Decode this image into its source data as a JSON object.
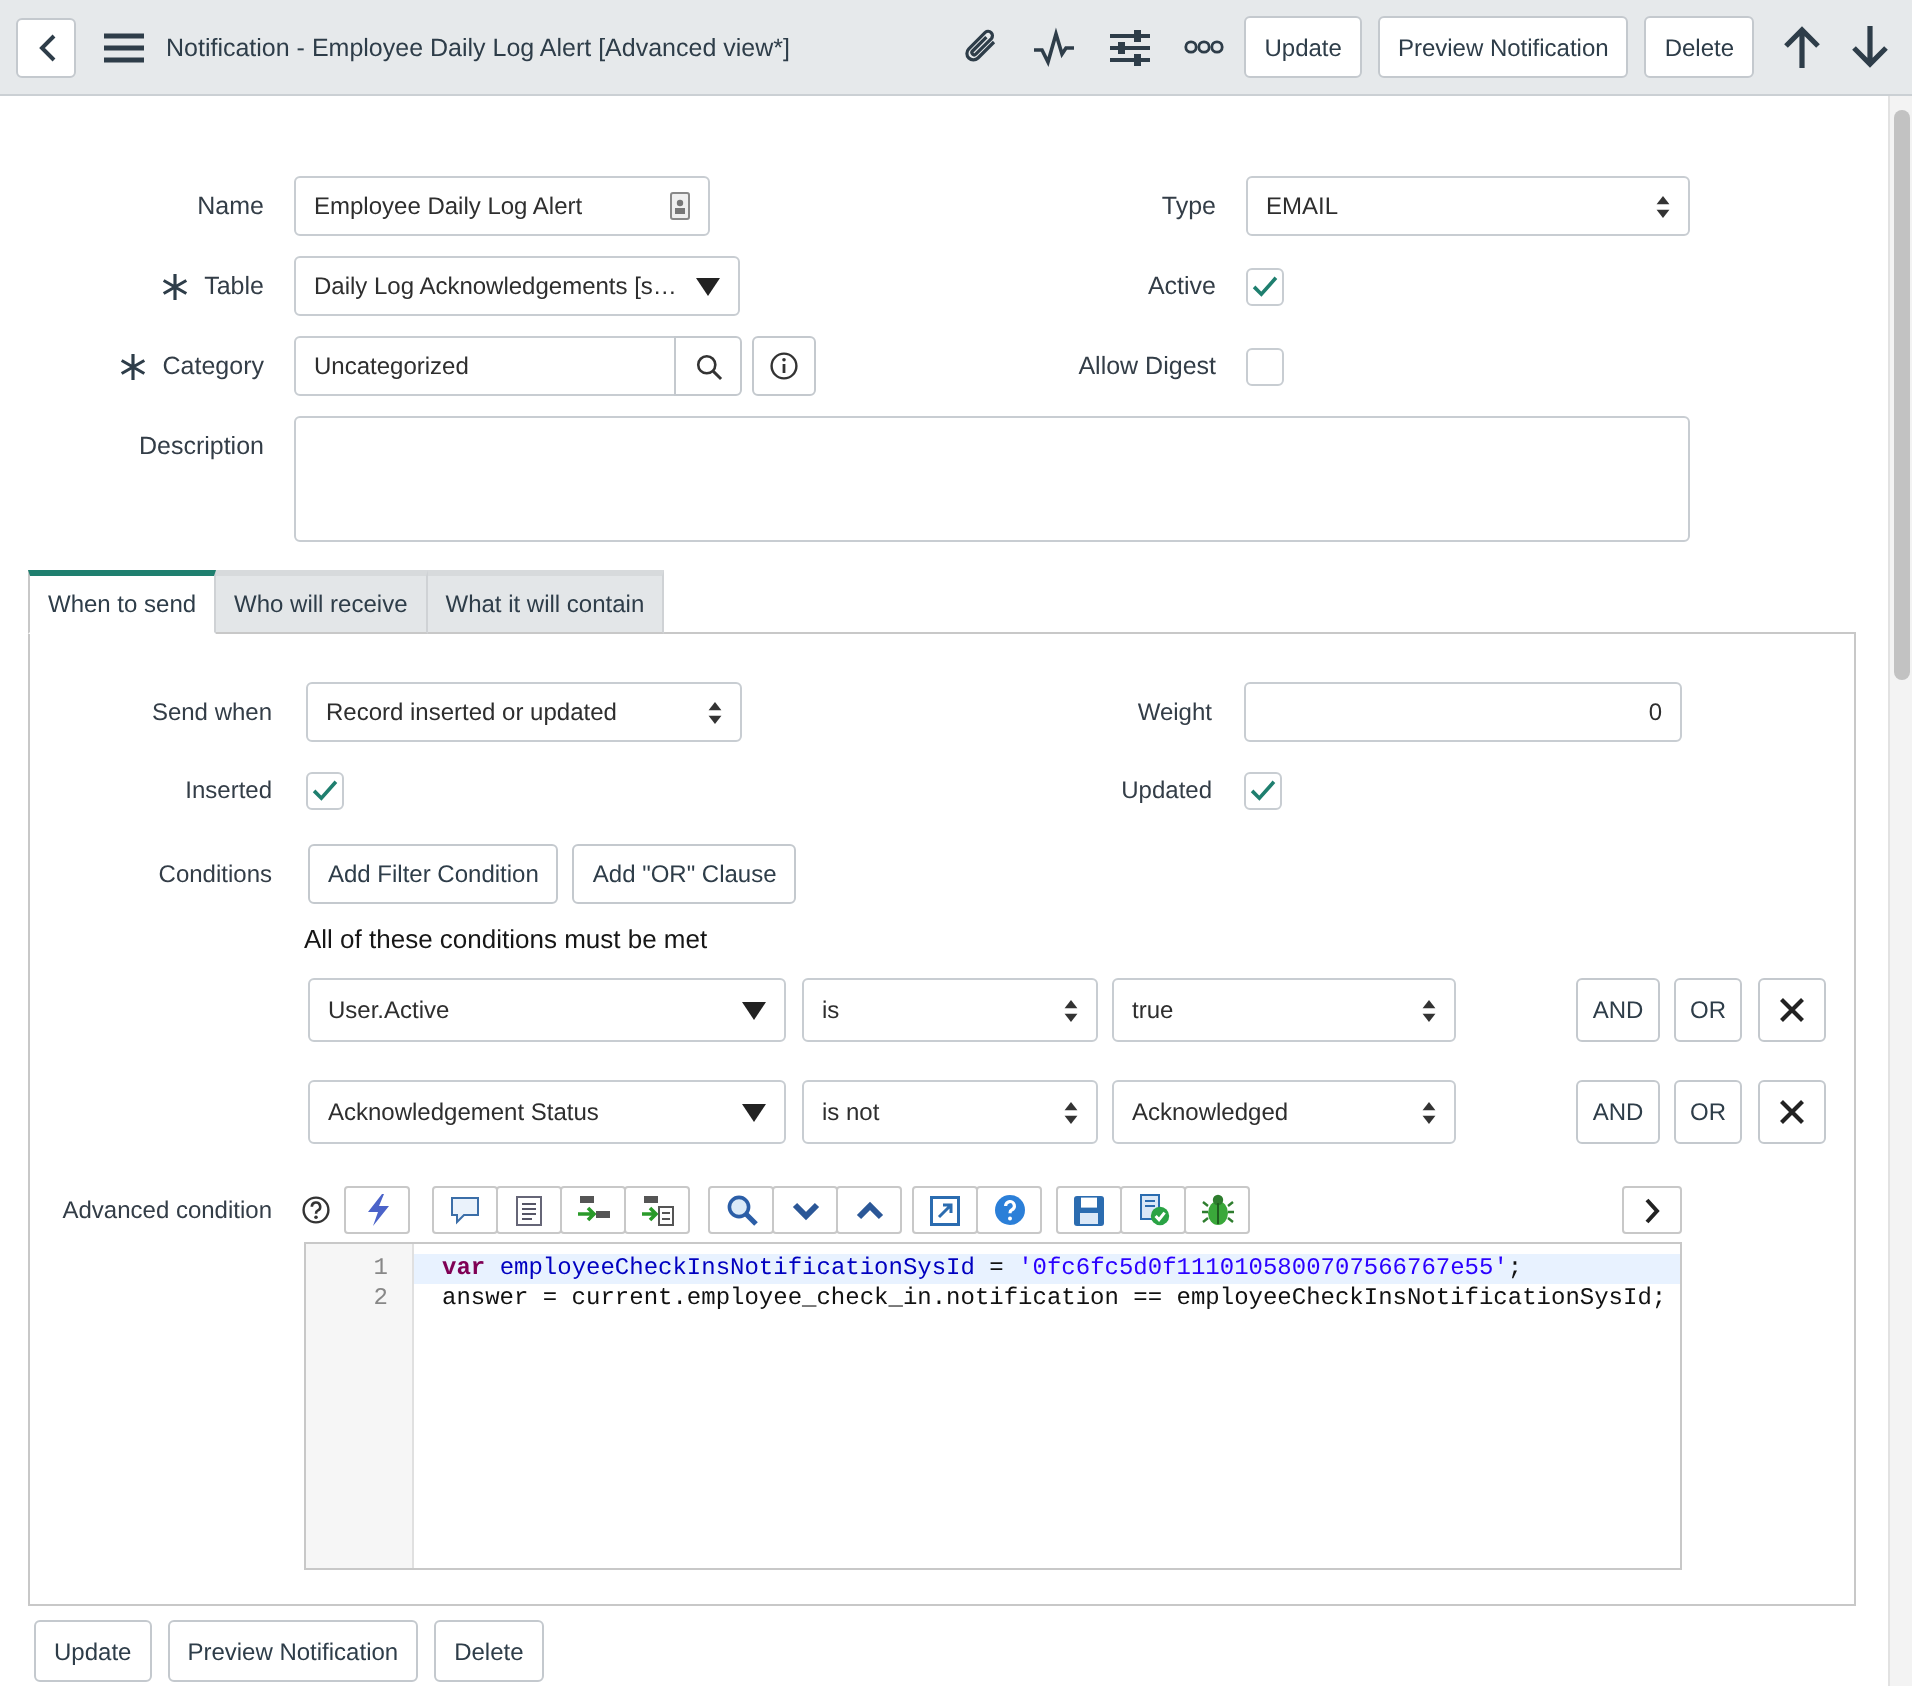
{
  "header": {
    "title": "Notification - Employee Daily Log Alert [Advanced view*]",
    "buttons": [
      "Update",
      "Preview Notification",
      "Delete"
    ]
  },
  "form": {
    "name": {
      "label": "Name",
      "required": false,
      "value": "Employee Daily Log Alert"
    },
    "table": {
      "label": "Table",
      "required": true,
      "value": "Daily Log Acknowledgements [s…"
    },
    "category": {
      "label": "Category",
      "required": true,
      "value": "Uncategorized"
    },
    "description": {
      "label": "Description",
      "required": false
    },
    "type": {
      "label": "Type",
      "value": "EMAIL"
    },
    "active": {
      "label": "Active",
      "checked": true
    },
    "allow_digest": {
      "label": "Allow Digest",
      "checked": false
    }
  },
  "tabs": [
    {
      "label": "When to send",
      "selected": true
    },
    {
      "label": "Who will receive",
      "selected": false
    },
    {
      "label": "What it will contain",
      "selected": false
    }
  ],
  "when_to_send": {
    "send_when": {
      "label": "Send when",
      "value": "Record inserted or updated"
    },
    "weight": {
      "label": "Weight",
      "value": "0"
    },
    "inserted": {
      "label": "Inserted",
      "checked": true
    },
    "updated": {
      "label": "Updated",
      "checked": true
    },
    "conditions": {
      "label": "Conditions",
      "buttons": [
        "Add Filter Condition",
        "Add \"OR\" Clause"
      ],
      "heading": "All of these conditions must be met",
      "rows": [
        {
          "field": "User.Active",
          "operator": "is",
          "value": "true",
          "and": "AND",
          "or": "OR"
        },
        {
          "field": "Acknowledgement Status",
          "operator": "is not",
          "value": "Acknowledged",
          "and": "AND",
          "or": "OR"
        }
      ]
    },
    "advanced_condition": {
      "label": "Advanced condition",
      "lines": [
        {
          "number": "1",
          "active": true,
          "tokens": [
            {
              "kind": "keyword",
              "text": "var "
            },
            {
              "kind": "def",
              "text": "employeeCheckInsNotificationSysId"
            },
            {
              "kind": "plain",
              "text": " = "
            },
            {
              "kind": "string",
              "text": "'0fc6fc5d0f1110105800707566767e55'"
            },
            {
              "kind": "plain",
              "text": ";"
            }
          ]
        },
        {
          "number": "2",
          "active": false,
          "tokens": [
            {
              "kind": "plain",
              "text": "answer = current.employee_check_in.notification == employeeCheckInsNotificationSysId;"
            }
          ]
        }
      ]
    }
  },
  "footer_buttons": [
    "Update",
    "Preview Notification",
    "Delete"
  ]
}
